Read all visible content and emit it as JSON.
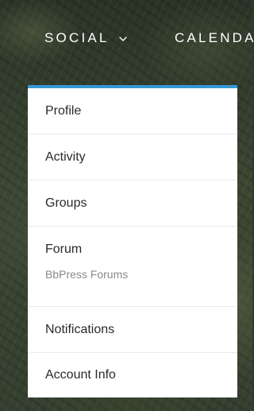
{
  "nav": {
    "social_label": "SOCIAL",
    "calendar_label": "CALENDA",
    "chevron_icon": "chevron-down-icon"
  },
  "dropdown": {
    "accent_color": "#3597d3",
    "items": [
      {
        "label": "Profile"
      },
      {
        "label": "Activity"
      },
      {
        "label": "Groups"
      },
      {
        "label": "Forum",
        "sublabel": "BbPress Forums"
      },
      {
        "label": "Notifications"
      },
      {
        "label": "Account Info"
      }
    ]
  }
}
